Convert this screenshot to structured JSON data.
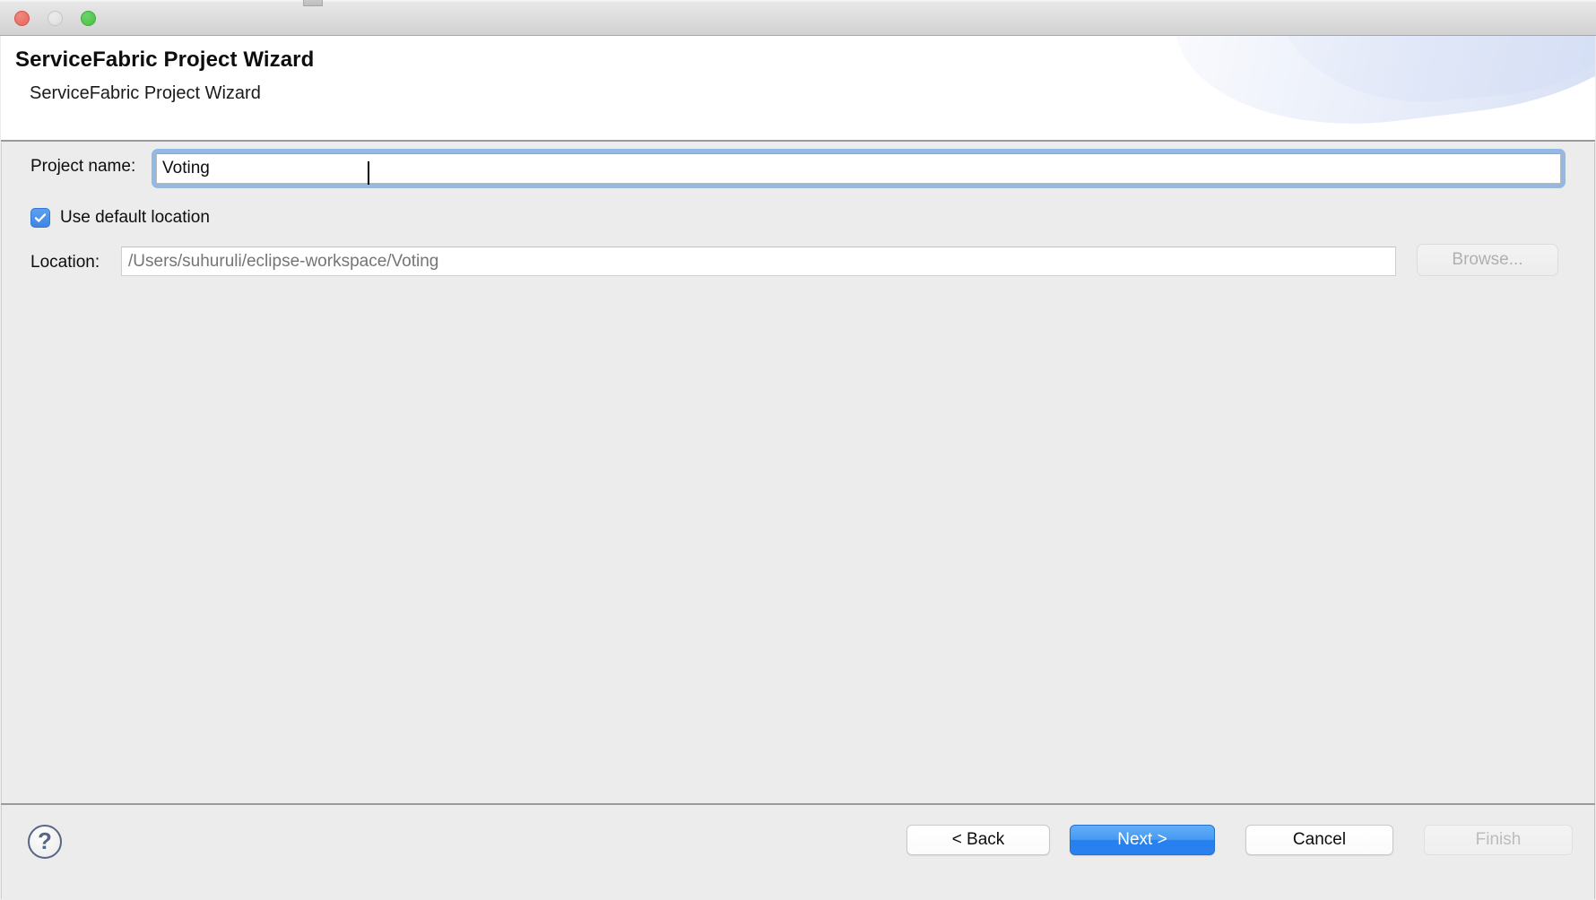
{
  "window": {
    "traffic_lights": [
      {
        "name": "close",
        "color": "#e8635a"
      },
      {
        "name": "minimize",
        "color": "#dcdcdc"
      },
      {
        "name": "zoom",
        "color": "#45c143"
      }
    ]
  },
  "header": {
    "title": "ServiceFabric Project Wizard",
    "subtitle": "ServiceFabric Project Wizard"
  },
  "form": {
    "project_name": {
      "label": "Project name:",
      "value": "Voting",
      "placeholder": ""
    },
    "use_default_location": {
      "label": "Use default location",
      "checked": true,
      "check_icon": "checkmark-icon",
      "accent_color": "#3f86e4"
    },
    "location": {
      "label": "Location:",
      "value": "",
      "placeholder": "/Users/suhuruli/eclipse-workspace/Voting",
      "enabled": false
    },
    "browse": {
      "label": "Browse...",
      "enabled": false
    }
  },
  "footer": {
    "help": {
      "icon": "question-mark-icon",
      "label": "?",
      "color": "#566685"
    },
    "buttons": [
      {
        "id": "back",
        "label": "< Back",
        "style": "normal",
        "enabled": true
      },
      {
        "id": "next",
        "label": "Next >",
        "style": "default",
        "enabled": true
      },
      {
        "id": "cancel",
        "label": "Cancel",
        "style": "normal",
        "enabled": true
      },
      {
        "id": "finish",
        "label": "Finish",
        "style": "disabled",
        "enabled": false
      }
    ]
  }
}
